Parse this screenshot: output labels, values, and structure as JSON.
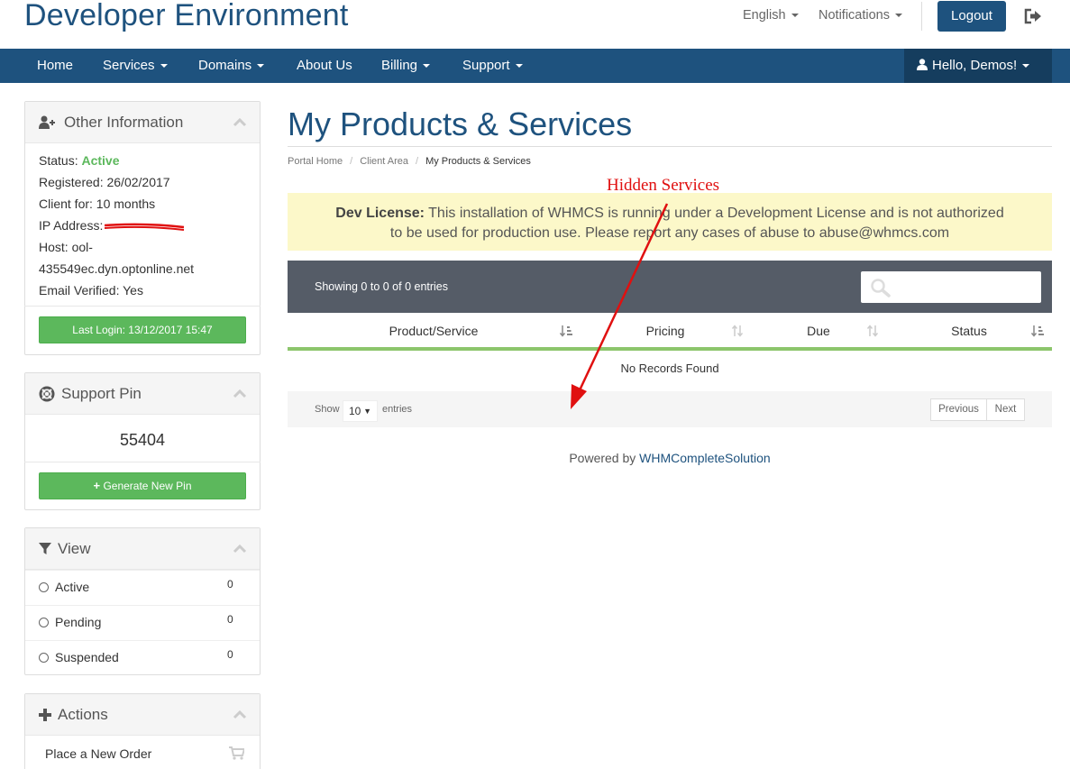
{
  "header": {
    "brand": "Developer Environment",
    "language": "English",
    "notifications": "Notifications",
    "logout_label": "Logout"
  },
  "nav": {
    "items": [
      "Home",
      "Services",
      "Domains",
      "About Us",
      "Billing",
      "Support"
    ],
    "user_greeting": "Hello, Demos!"
  },
  "sidebar": {
    "other_info": {
      "title": "Other Information",
      "status_label": "Status:",
      "status_value": "Active",
      "registered": "Registered: 26/02/2017",
      "client_for": "Client for: 10 months",
      "ip_label": "IP Address:",
      "host_line1": "Host: ool-",
      "host_line2": "435549ec.dyn.optonline.net",
      "email_verified": "Email Verified: Yes",
      "last_login": "Last Login: 13/12/2017 15:47"
    },
    "support_pin": {
      "title": "Support Pin",
      "pin": "55404",
      "generate_label": "Generate New Pin"
    },
    "view": {
      "title": "View",
      "items": [
        {
          "label": "Active",
          "count": "0"
        },
        {
          "label": "Pending",
          "count": "0"
        },
        {
          "label": "Suspended",
          "count": "0"
        }
      ]
    },
    "actions": {
      "title": "Actions",
      "items": [
        "Place a New Order"
      ]
    }
  },
  "main": {
    "title": "My Products & Services",
    "breadcrumb": [
      "Portal Home",
      "Client Area",
      "My Products & Services"
    ],
    "alert_bold": "Dev License:",
    "alert_text_line1": "This installation of WHMCS is running under a Development License and is not authorized",
    "alert_text_line2": "to be used for production use. Please report any cases of abuse to abuse@whmcs.com",
    "showing": "Showing 0 to 0 of 0 entries",
    "columns": [
      "Product/Service",
      "Pricing",
      "Due",
      "Status"
    ],
    "empty": "No Records Found",
    "show_label": "Show",
    "page_length": "10",
    "entries_label": "entries",
    "previous": "Previous",
    "next": "Next",
    "powered_prefix": "Powered by",
    "powered_link": "WHMCompleteSolution"
  },
  "annotation": {
    "label": "Hidden Services"
  },
  "colors": {
    "brand_blue": "#1e527e",
    "success_green": "#5cb85c",
    "annotation_red": "#e01010",
    "alert_bg": "#fcf8c9"
  }
}
